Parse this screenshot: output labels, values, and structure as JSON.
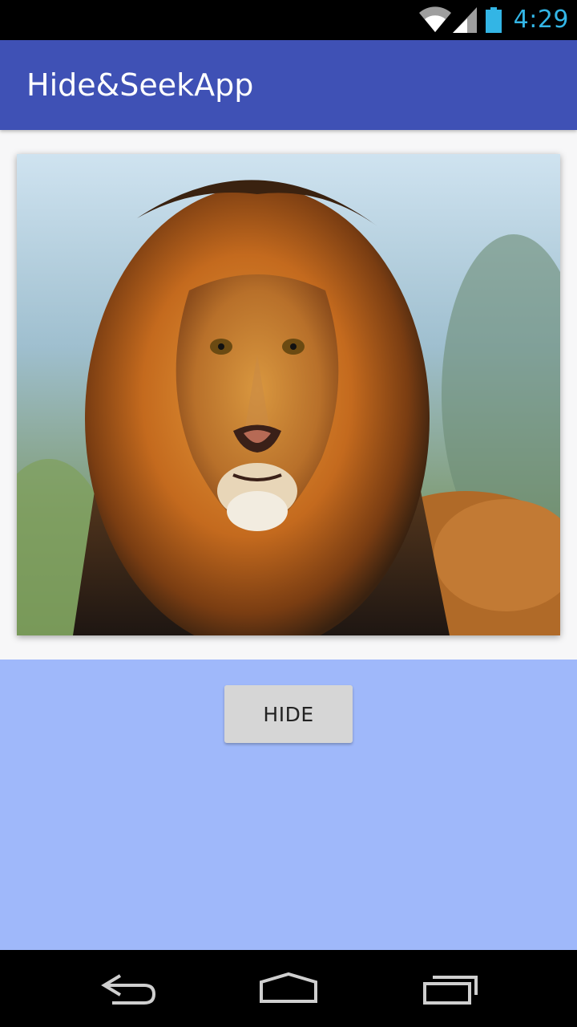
{
  "status_bar": {
    "time": "4:29",
    "icons": [
      "wifi-icon",
      "cell-signal-icon",
      "battery-icon"
    ],
    "icon_color": "#33b5e5"
  },
  "app_bar": {
    "title": "Hide&SeekApp",
    "color": "#3f51b5"
  },
  "main": {
    "image_subject": "lion-photo",
    "hide_button_label": "HIDE",
    "background_color": "#9fb8fa"
  },
  "nav_bar": {
    "icons": [
      "back-icon",
      "home-icon",
      "recents-icon"
    ]
  }
}
